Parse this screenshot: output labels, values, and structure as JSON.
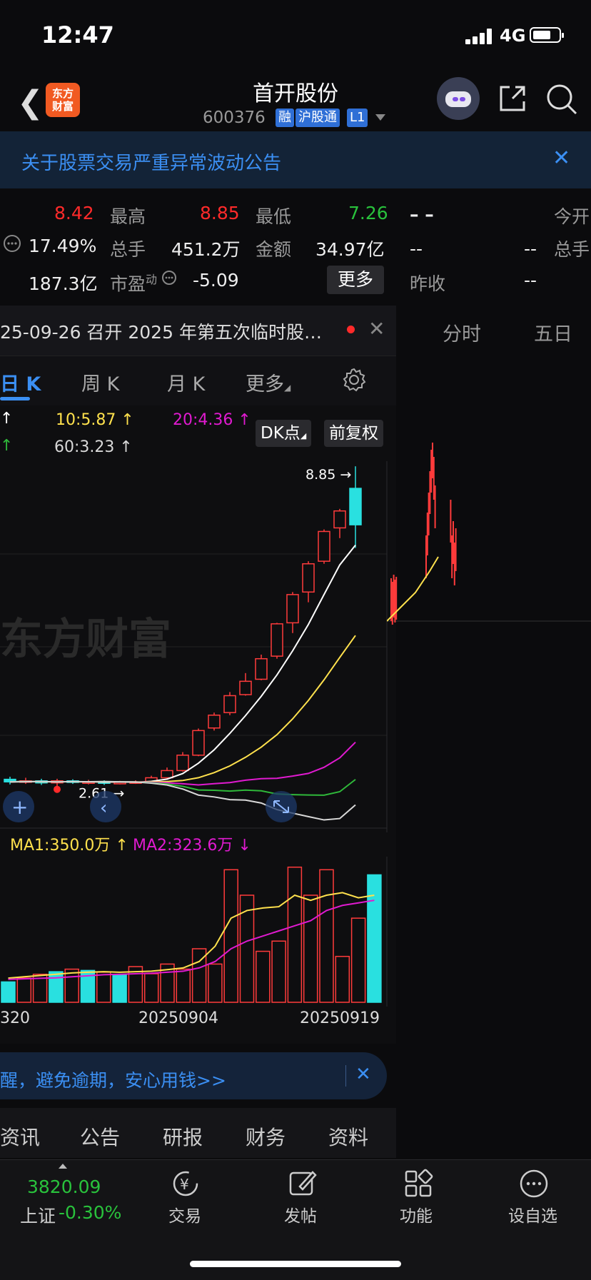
{
  "status_bar": {
    "time": "12:47",
    "network": "4G"
  },
  "header": {
    "logo_line1": "东方",
    "logo_line2": "财富",
    "stock_name": "首开股份",
    "stock_code": "600376",
    "tags": [
      "融",
      "沪股通",
      "L1"
    ]
  },
  "banner": {
    "text": "关于股票交易严重异常波动公告"
  },
  "quote": {
    "price": "8.42",
    "high_label": "最高",
    "high": "8.85",
    "low_label": "最低",
    "low": "7.26",
    "dash_big": "– –",
    "open_label": "今开",
    "turnover_rate": "17.49%",
    "volume_label": "总手",
    "volume": "451.2万",
    "amount_label": "金额",
    "amount": "34.97亿",
    "dash1": "--",
    "dash2": "--",
    "volume_label2": "总手",
    "market_cap": "187.3亿",
    "pe_label": "市盈",
    "pe_sup": "动",
    "pe": "-5.09",
    "more_button": "更多",
    "prev_close_label": "昨收",
    "dash3": "--"
  },
  "notice": {
    "text": "25-09-26 召开 2025 年第五次临时股…"
  },
  "right_tabs": [
    "分时",
    "五日"
  ],
  "kline_tabs": [
    "日 K",
    "周 K",
    "月 K",
    "更多"
  ],
  "ma_legend": {
    "ma10": "10:5.87",
    "ma20": "20:4.36",
    "ma60": "60:3.23",
    "arrow": "↑",
    "colors": {
      "ma5": "#ffffff",
      "ma10": "#ffe14d",
      "ma20": "#e01ad0",
      "ma60": "#2fb83a",
      "ma120": "#d8d8d8"
    }
  },
  "chart_buttons": {
    "dk": "DK点",
    "fq": "前复权"
  },
  "chart_text": {
    "high_mark": "8.85",
    "low_mark": "2.61",
    "watermark": "东方财富"
  },
  "volume_legend": {
    "ma1": "MA1:350.0万",
    "ma1_arrow": "↑",
    "ma2": "MA2:323.6万",
    "ma2_arrow": "↓"
  },
  "date_axis": [
    "320",
    "20250904",
    "20250919"
  ],
  "ad_banner": {
    "text": "醒，避免逾期，安心用钱>>"
  },
  "bottom_tabs": [
    "资讯",
    "公告",
    "研报",
    "财务",
    "资料"
  ],
  "tab_bar": {
    "index_value": "3820.09",
    "index_name": "上证",
    "index_change": "-0.30%",
    "items": [
      "交易",
      "发帖",
      "功能",
      "设自选"
    ]
  },
  "chart_data": {
    "type": "candlestick",
    "candles": [
      {
        "o": 2.75,
        "c": 2.7,
        "h": 2.8,
        "l": 2.65
      },
      {
        "o": 2.7,
        "c": 2.72,
        "h": 2.78,
        "l": 2.66
      },
      {
        "o": 2.72,
        "c": 2.68,
        "h": 2.76,
        "l": 2.64
      },
      {
        "o": 2.68,
        "c": 2.72,
        "h": 2.76,
        "l": 2.61
      },
      {
        "o": 2.72,
        "c": 2.69,
        "h": 2.75,
        "l": 2.66
      },
      {
        "o": 2.69,
        "c": 2.7,
        "h": 2.74,
        "l": 2.65
      },
      {
        "o": 2.7,
        "c": 2.68,
        "h": 2.73,
        "l": 2.64
      },
      {
        "o": 2.68,
        "c": 2.69,
        "h": 2.72,
        "l": 2.65
      },
      {
        "o": 2.69,
        "c": 2.7,
        "h": 2.73,
        "l": 2.66
      },
      {
        "o": 2.7,
        "c": 2.78,
        "h": 2.82,
        "l": 2.68
      },
      {
        "o": 2.78,
        "c": 2.92,
        "h": 2.98,
        "l": 2.76
      },
      {
        "o": 2.92,
        "c": 3.22,
        "h": 3.28,
        "l": 2.9
      },
      {
        "o": 3.22,
        "c": 3.7,
        "h": 3.74,
        "l": 3.2
      },
      {
        "o": 3.75,
        "c": 4.0,
        "h": 4.05,
        "l": 3.7
      },
      {
        "o": 4.05,
        "c": 4.38,
        "h": 4.45,
        "l": 4.0
      },
      {
        "o": 4.4,
        "c": 4.66,
        "h": 4.82,
        "l": 4.38
      },
      {
        "o": 4.7,
        "c": 5.1,
        "h": 5.18,
        "l": 4.68
      },
      {
        "o": 5.15,
        "c": 5.78,
        "h": 5.8,
        "l": 5.1
      },
      {
        "o": 5.8,
        "c": 6.35,
        "h": 6.4,
        "l": 5.6
      },
      {
        "o": 6.4,
        "c": 6.95,
        "h": 7.0,
        "l": 6.2
      },
      {
        "o": 7.0,
        "c": 7.58,
        "h": 7.62,
        "l": 6.95
      },
      {
        "o": 7.65,
        "c": 7.98,
        "h": 8.02,
        "l": 7.45
      },
      {
        "o": 8.42,
        "c": 7.71,
        "h": 8.85,
        "l": 7.26
      }
    ],
    "ylim": [
      2.55,
      8.95
    ],
    "volume": {
      "values": [
        80,
        95,
        110,
        120,
        130,
        125,
        118,
        110,
        140,
        112,
        150,
        130,
        210,
        150,
        520,
        420,
        200,
        240,
        530,
        420,
        520,
        180,
        330,
        500
      ],
      "ylim": [
        0,
        560
      ],
      "ma1": [
        95,
        100,
        105,
        110,
        115,
        118,
        120,
        118,
        120,
        122,
        128,
        135,
        160,
        220,
        330,
        360,
        370,
        375,
        420,
        400,
        420,
        430,
        410,
        420
      ],
      "ma2": [
        90,
        92,
        94,
        96,
        100,
        104,
        108,
        110,
        112,
        114,
        118,
        122,
        135,
        160,
        210,
        240,
        260,
        280,
        300,
        320,
        360,
        380,
        390,
        400
      ]
    }
  }
}
